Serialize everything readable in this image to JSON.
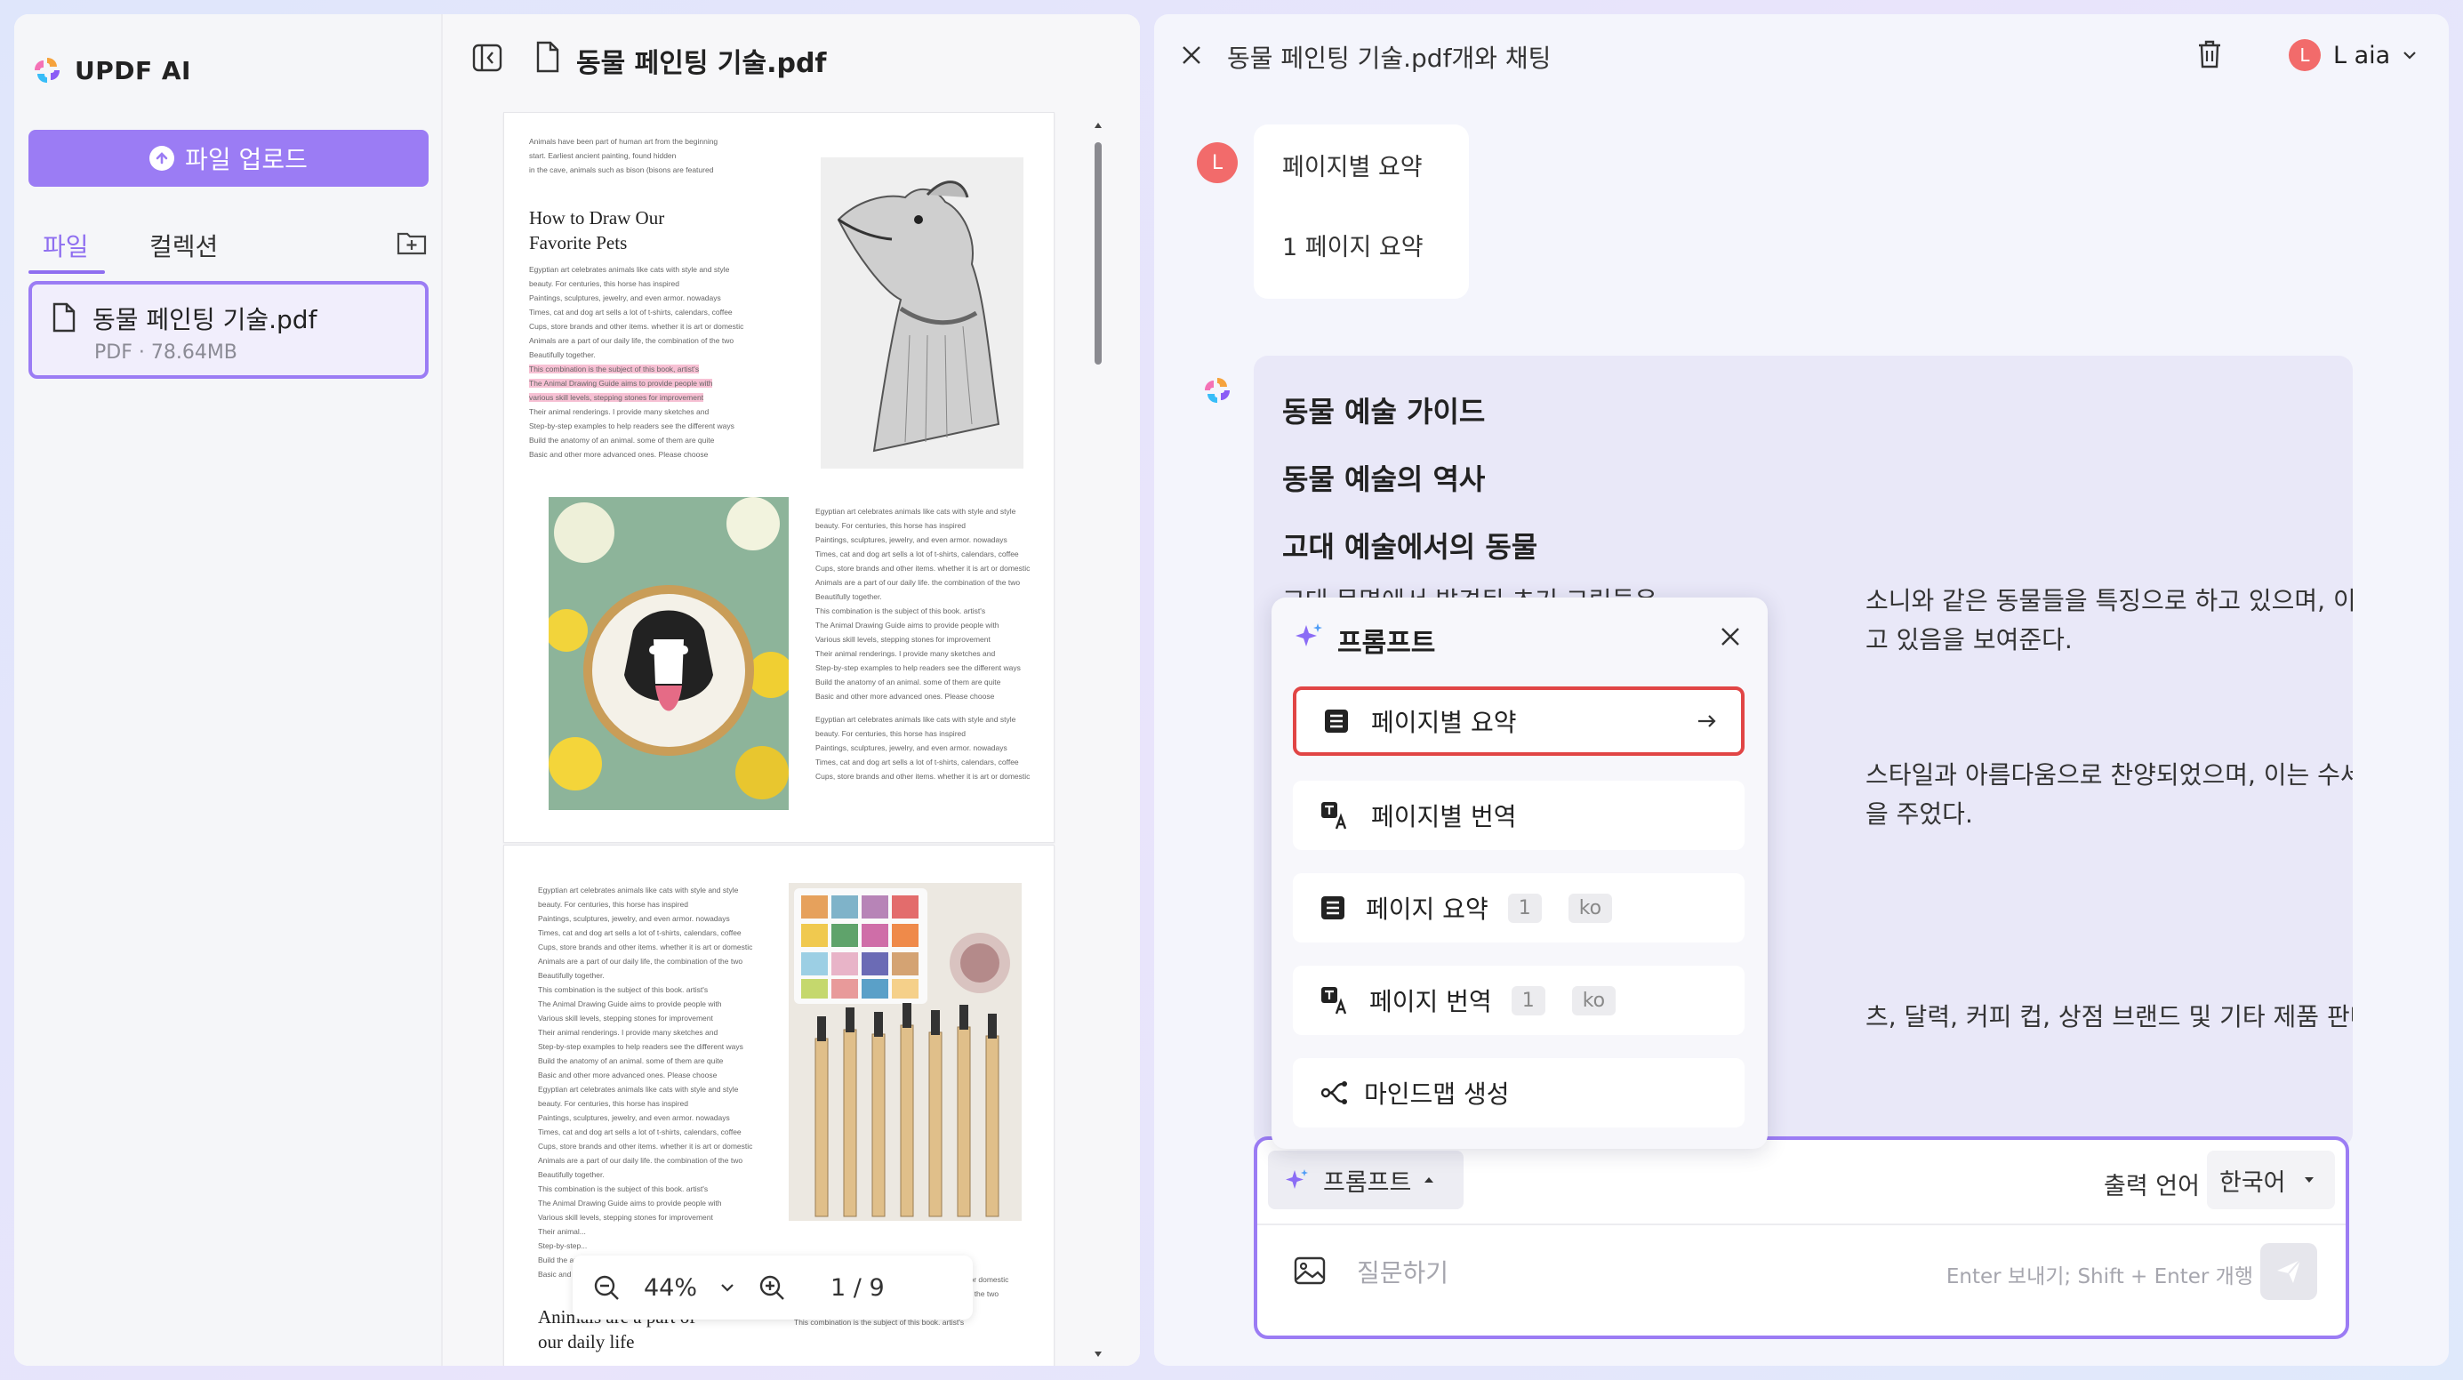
{
  "app": {
    "name": "UPDF AI"
  },
  "sidebar": {
    "upload_label": "파일 업로드",
    "tabs": [
      {
        "label": "파일"
      },
      {
        "label": "컬렉션"
      }
    ],
    "file": {
      "name": "동물 페인팅 기술.pdf",
      "meta": "PDF · 78.64MB"
    }
  },
  "viewer": {
    "title": "동물 페인팅 기술.pdf",
    "page1": {
      "heading1": "How to Draw Our",
      "heading2": "Favorite Pets",
      "intro": "Animals have been part of human art from the beginning",
      "intro2": "start. Earliest ancient painting, found hidden",
      "intro3": "in the cave, animals such as bison (bisons are featured",
      "hl1": "This combination is the subject of this book, artist's",
      "hl2": "The Animal Drawing Guide aims to provide people with",
      "hl3": "various skill levels, stepping stones for improvement",
      "body": "Egyptian art celebrates animals like cats with style and style beauty. For centuries, this horse has inspired"
    },
    "page2": {
      "heading1": "Animals are a part of",
      "heading2": "our daily life"
    },
    "zoom": {
      "level": "44%",
      "page": "1 / 9"
    }
  },
  "chat": {
    "title": "동물 페인팅 기술.pdf개와 채팅",
    "user": {
      "name": "L aia",
      "initial": "L"
    },
    "user_message": {
      "line1": "페이지별 요약",
      "line2": "1 페이지 요약"
    },
    "ai_message": {
      "h1": "동물 예술 가이드",
      "h2": "동물 예술의 역사",
      "h3": "고대 예술에서의 동물",
      "p1_left": "고대 문명에서 발견된 초기 그림들은 ",
      "p1_right": "소니와 같은 동물들을 특징으로 하고 있으며, 이는 인",
      "p1_line2": "고 있음을 보여준다.",
      "p2_right": "스타일과 아름다움으로 찬양되었으며, 이는 수세",
      "p2_line2": "을 주었다.",
      "p3_right": "츠, 달력, 커피 컵, 상점 브랜드 및 기타 제품 판매"
    },
    "prompt_popup": {
      "title": "프롬프트",
      "items": [
        {
          "label": "페이지별 요약"
        },
        {
          "label": "페이지별 번역"
        },
        {
          "label": "페이지 요약",
          "page": "1",
          "lang": "ko"
        },
        {
          "label": "페이지 번역",
          "page": "1",
          "lang": "ko"
        },
        {
          "label": "마인드맵 생성"
        }
      ]
    },
    "input": {
      "prompt_button": "프롬프트",
      "output_lang_label": "출력 언어",
      "output_lang": "한국어",
      "placeholder": "질문하기",
      "hint": "Enter 보내기; Shift + Enter 개행"
    }
  },
  "colors": {
    "accent": "#9b7cf4",
    "highlight_border": "#e14545",
    "avatar": "#f26b6b"
  }
}
